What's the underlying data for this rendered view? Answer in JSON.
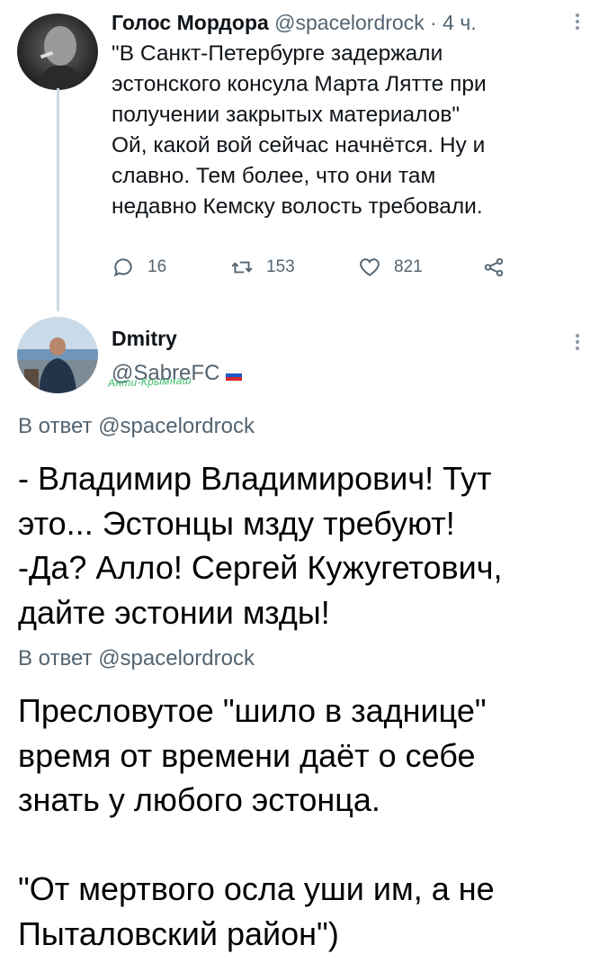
{
  "tweet1": {
    "name": "Голос Мордора",
    "handle": "@spacelordrock",
    "separator": "·",
    "time": "4 ч.",
    "text": "\"В Санкт-Петербурге задержали\nэстонского консула Марта Лятте при\nполучении закрытых материалов\"\nОй, какой вой сейчас начнётся. Ну и\nславно. Тем более, что они там\nнедавно Кемску волость требовали.",
    "actions": {
      "replies": "16",
      "retweets": "153",
      "likes": "821"
    },
    "icons": [
      "comment-icon",
      "retweet-icon",
      "heart-icon",
      "share-icon",
      "more-icon"
    ]
  },
  "tweet2": {
    "name": "Dmitry",
    "handle": "@SabreFC",
    "watermark": "Анти-Крымнаш",
    "flag": "russian-flag-emoji",
    "reply_to_prefix": "В ответ",
    "reply_to_handle": "@spacelordrock",
    "text": "- Владимир Владимирович! Тут\nэто... Эстонцы мзду требуют!\n-Да? Алло! Сергей Кужугетович,\nдайте эстонии мзды!"
  },
  "tweet3": {
    "reply_to_prefix": "В ответ",
    "reply_to_handle": "@spacelordrock",
    "text": "Пресловутое \"шило в заднице\"\nвремя от времени даёт о себе\nзнать у любого эстонца.\n\n\"От мертвого осла уши им, а не\nПыталовский район\")"
  },
  "colors": {
    "text": "#0f1419",
    "muted": "#536471",
    "thread": "#cfd9de",
    "watermark": "#3dbb6a"
  }
}
